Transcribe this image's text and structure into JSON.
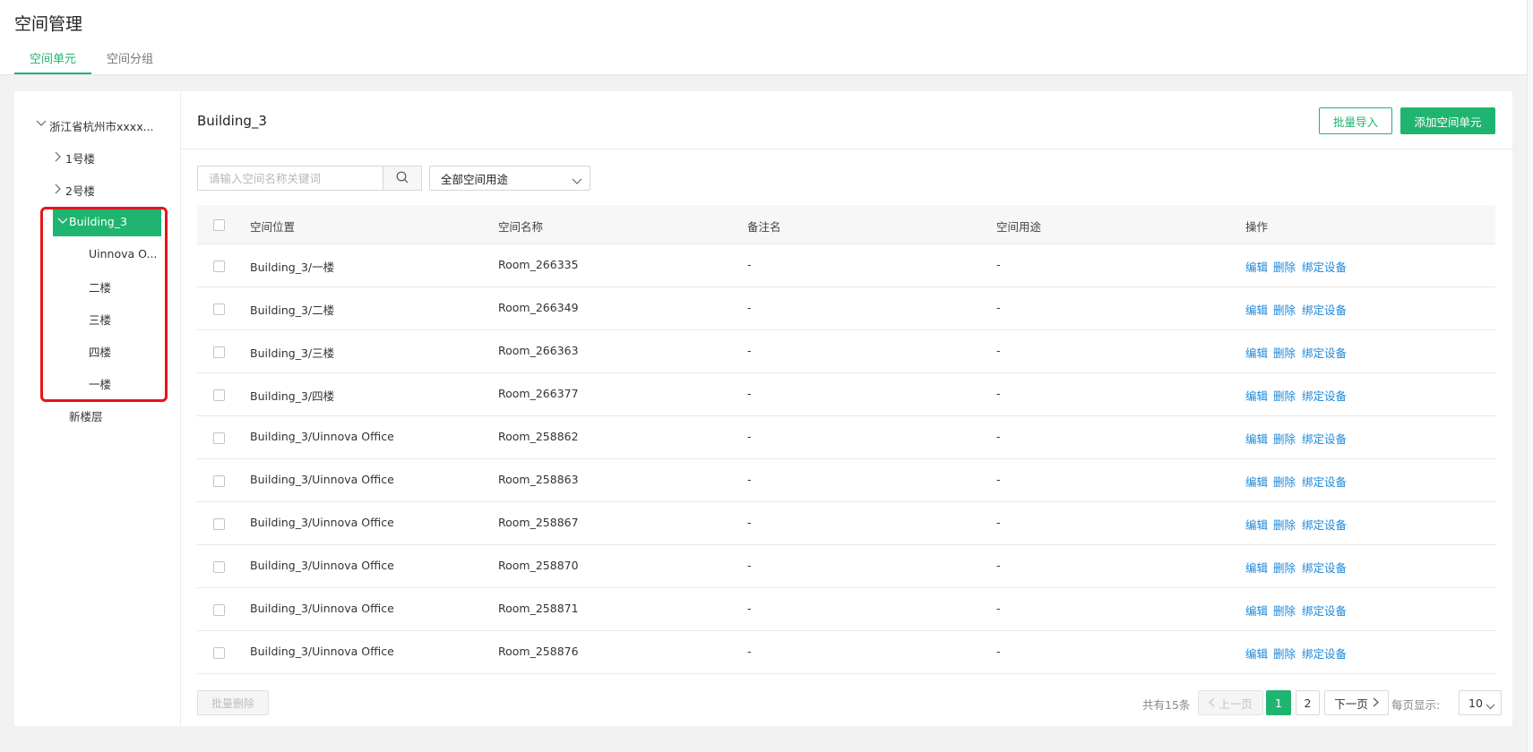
{
  "header": {
    "title": "空间管理",
    "tabs": [
      {
        "label": "空间单元",
        "active": true
      },
      {
        "label": "空间分组",
        "active": false
      }
    ]
  },
  "tree": {
    "root": "浙江省杭州市xxxx...",
    "nodes": [
      {
        "label": "1号楼",
        "expanded": false
      },
      {
        "label": "2号楼",
        "expanded": false
      },
      {
        "label": "Building_3",
        "expanded": true,
        "selected": true,
        "children": [
          "Uinnova O...",
          "二楼",
          "三楼",
          "四楼",
          "一楼"
        ]
      }
    ],
    "extra": "新楼层"
  },
  "main": {
    "title": "Building_3",
    "import_button": "批量导入",
    "add_button": "添加空间单元",
    "search_placeholder": "请输入空间名称关键词",
    "search_icon": "search-icon",
    "filter_selected": "全部空间用途"
  },
  "table": {
    "columns": [
      "空间位置",
      "空间名称",
      "备注名",
      "空间用途",
      "操作"
    ],
    "actions": [
      "编辑",
      "删除",
      "绑定设备"
    ],
    "rows": [
      {
        "location": "Building_3/一楼",
        "name": "Room_266335",
        "remark": "-",
        "usage": "-"
      },
      {
        "location": "Building_3/二楼",
        "name": "Room_266349",
        "remark": "-",
        "usage": "-"
      },
      {
        "location": "Building_3/三楼",
        "name": "Room_266363",
        "remark": "-",
        "usage": "-"
      },
      {
        "location": "Building_3/四楼",
        "name": "Room_266377",
        "remark": "-",
        "usage": "-"
      },
      {
        "location": "Building_3/Uinnova Office",
        "name": "Room_258862",
        "remark": "-",
        "usage": "-"
      },
      {
        "location": "Building_3/Uinnova Office",
        "name": "Room_258863",
        "remark": "-",
        "usage": "-"
      },
      {
        "location": "Building_3/Uinnova Office",
        "name": "Room_258867",
        "remark": "-",
        "usage": "-"
      },
      {
        "location": "Building_3/Uinnova Office",
        "name": "Room_258870",
        "remark": "-",
        "usage": "-"
      },
      {
        "location": "Building_3/Uinnova Office",
        "name": "Room_258871",
        "remark": "-",
        "usage": "-"
      },
      {
        "location": "Building_3/Uinnova Office",
        "name": "Room_258876",
        "remark": "-",
        "usage": "-"
      }
    ]
  },
  "footer": {
    "batch_delete": "批量删除",
    "total": "共有15条",
    "prev": "上一页",
    "pages": [
      "1",
      "2"
    ],
    "current_page": "1",
    "next": "下一页",
    "page_size_label": "每页显示:",
    "page_size": "10"
  },
  "colors": {
    "accent": "#1fb570",
    "link": "#1e88d8",
    "highlight_box": "#e8141b"
  }
}
